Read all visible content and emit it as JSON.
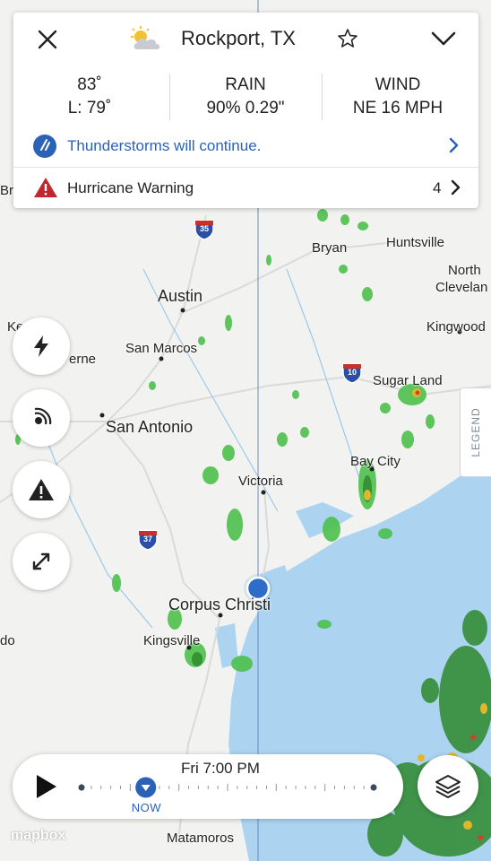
{
  "header": {
    "location": "Rockport, TX",
    "close_icon": "close-icon",
    "weather_icon": "partly-cloudy-icon",
    "favorite_icon": "star-outline-icon",
    "collapse_icon": "chevron-down-icon"
  },
  "conditions": {
    "temp": "83˚",
    "low": "L: 79˚",
    "rain_label": "RAIN",
    "rain_value": "90% 0.29\"",
    "wind_label": "WIND",
    "wind_value": "NE 16 MPH"
  },
  "forecast_alert": {
    "text": "Thunderstorms will continue.",
    "color": "#2a62b8"
  },
  "warning": {
    "text": "Hurricane Warning",
    "count": "4",
    "color": "#c0282d"
  },
  "map": {
    "cities": [
      "Bryan",
      "Huntsville",
      "North",
      "Clevelan",
      "Austin",
      "Kingwood",
      "San Marcos",
      "erne",
      "Sugar Land",
      "San Antonio",
      "Bay City",
      "Victoria",
      "Corpus Christi",
      "Kingsville",
      "do",
      "Matamoros",
      "Ke",
      "Bra"
    ],
    "interstates": [
      "35",
      "10",
      "37"
    ],
    "legend_label": "LEGEND"
  },
  "tools": {
    "lightning": "lightning-icon",
    "radar": "radar-icon",
    "alerts": "warning-icon",
    "expand": "expand-icon"
  },
  "timeline": {
    "time": "Fri 7:00 PM",
    "now_label": "NOW",
    "progress": 0.22
  },
  "attribution": "mapbox"
}
